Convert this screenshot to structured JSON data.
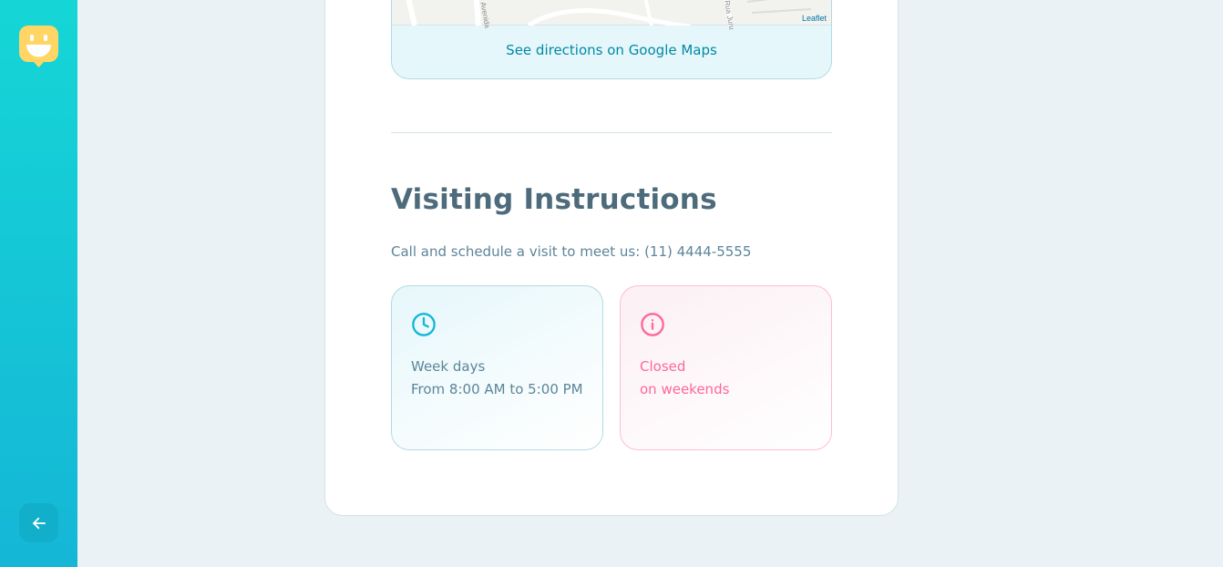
{
  "sidebar": {
    "logo_icon": "happy-face-marker-icon",
    "back_icon": "arrow-left-icon"
  },
  "map": {
    "attribution": "Leaflet",
    "streets": [
      "Avenida",
      "Rua Juru"
    ],
    "directions_link": "See directions on Google Maps"
  },
  "visiting": {
    "title": "Visiting Instructions",
    "description": "Call and schedule a visit to meet us: (11) 4444-5555"
  },
  "opening_hours": {
    "icon": "clock-icon",
    "line1": "Week days",
    "line2": "From 8:00 AM to 5:00 PM"
  },
  "weekends": {
    "icon": "info-icon",
    "line1": "Closed",
    "line2": "on weekends"
  },
  "colors": {
    "sidebar_top": "#15d6d6",
    "sidebar_bottom": "#15b6d6",
    "logo": "#ffd666",
    "title": "#4d6b7a",
    "text": "#5c8599",
    "link": "#0089a5",
    "blue_accent": "#15b6d6",
    "pink_accent": "#ff669d"
  }
}
